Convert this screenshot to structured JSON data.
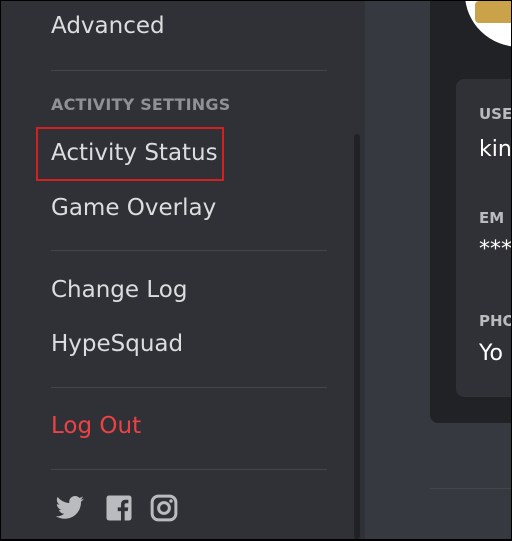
{
  "sidebar": {
    "advanced_label": "Advanced",
    "activity_header": "ACTIVITY SETTINGS",
    "activity_status_label": "Activity Status",
    "game_overlay_label": "Game Overlay",
    "change_log_label": "Change Log",
    "hypesquad_label": "HypeSquad",
    "logout_label": "Log Out",
    "social_icons": [
      "twitter-icon",
      "facebook-icon",
      "instagram-icon"
    ]
  },
  "account_card": {
    "username_label": "USE",
    "username_value": "kin",
    "email_label": "EM",
    "email_value": "***",
    "phone_label": "PHO",
    "phone_value": "Yo"
  },
  "colors": {
    "sidebar_bg": "#2f3136",
    "main_bg": "#36393f",
    "logout": "#ed4245",
    "highlight_box": "#d32020"
  }
}
